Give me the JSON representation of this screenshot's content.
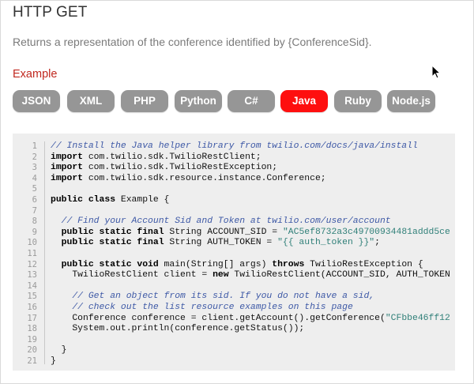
{
  "header": {
    "title": "HTTP GET",
    "description": "Returns a representation of the conference identified by {ConferenceSid}.",
    "example_label": "Example"
  },
  "tabs": [
    {
      "label": "JSON",
      "active": false
    },
    {
      "label": "XML",
      "active": false
    },
    {
      "label": "PHP",
      "active": false
    },
    {
      "label": "Python",
      "active": false
    },
    {
      "label": "C#",
      "active": false
    },
    {
      "label": "Java",
      "active": true
    },
    {
      "label": "Ruby",
      "active": false
    },
    {
      "label": "Node.js",
      "active": false
    }
  ],
  "colors": {
    "tab_inactive": "#969696",
    "tab_active": "#fe0f0f",
    "example_label": "#c0281f",
    "code_background": "#eeeeee",
    "comment": "#3e59a6",
    "string": "#2f7f78"
  },
  "code": {
    "language": "Java",
    "lines": [
      [
        {
          "t": "c",
          "v": "// Install the Java helper library from twilio.com/docs/java/install"
        }
      ],
      [
        {
          "t": "k",
          "v": "import"
        },
        {
          "t": "p",
          "v": " com.twilio.sdk.TwilioRestClient;"
        }
      ],
      [
        {
          "t": "k",
          "v": "import"
        },
        {
          "t": "p",
          "v": " com.twilio.sdk.TwilioRestException;"
        }
      ],
      [
        {
          "t": "k",
          "v": "import"
        },
        {
          "t": "p",
          "v": " com.twilio.sdk.resource.instance.Conference;"
        }
      ],
      [],
      [
        {
          "t": "k",
          "v": "public class"
        },
        {
          "t": "p",
          "v": " Example {"
        }
      ],
      [],
      [
        {
          "t": "p",
          "v": "  "
        },
        {
          "t": "c",
          "v": "// Find your Account Sid and Token at twilio.com/user/account"
        }
      ],
      [
        {
          "t": "p",
          "v": "  "
        },
        {
          "t": "k",
          "v": "public static final"
        },
        {
          "t": "p",
          "v": " String ACCOUNT_SID = "
        },
        {
          "t": "s",
          "v": "\"AC5ef8732a3c49700934481addd5ce"
        }
      ],
      [
        {
          "t": "p",
          "v": "  "
        },
        {
          "t": "k",
          "v": "public static final"
        },
        {
          "t": "p",
          "v": " String AUTH_TOKEN = "
        },
        {
          "t": "s",
          "v": "\"{{ auth_token }}\""
        },
        {
          "t": "p",
          "v": ";"
        }
      ],
      [],
      [
        {
          "t": "p",
          "v": "  "
        },
        {
          "t": "k",
          "v": "public static void"
        },
        {
          "t": "p",
          "v": " main(String[] args) "
        },
        {
          "t": "k",
          "v": "throws"
        },
        {
          "t": "p",
          "v": " TwilioRestException {"
        }
      ],
      [
        {
          "t": "p",
          "v": "    TwilioRestClient client = "
        },
        {
          "t": "k",
          "v": "new"
        },
        {
          "t": "p",
          "v": " TwilioRestClient(ACCOUNT_SID, AUTH_TOKEN"
        }
      ],
      [],
      [
        {
          "t": "p",
          "v": "    "
        },
        {
          "t": "c",
          "v": "// Get an object from its sid. If you do not have a sid,"
        }
      ],
      [
        {
          "t": "p",
          "v": "    "
        },
        {
          "t": "c",
          "v": "// check out the list resource examples on this page"
        }
      ],
      [
        {
          "t": "p",
          "v": "    Conference conference = client.getAccount().getConference("
        },
        {
          "t": "s",
          "v": "\"CFbbe46ff12"
        }
      ],
      [
        {
          "t": "p",
          "v": "    System.out.println(conference.getStatus());"
        }
      ],
      [],
      [
        {
          "t": "p",
          "v": "  }"
        }
      ],
      [
        {
          "t": "p",
          "v": "}"
        }
      ]
    ]
  }
}
